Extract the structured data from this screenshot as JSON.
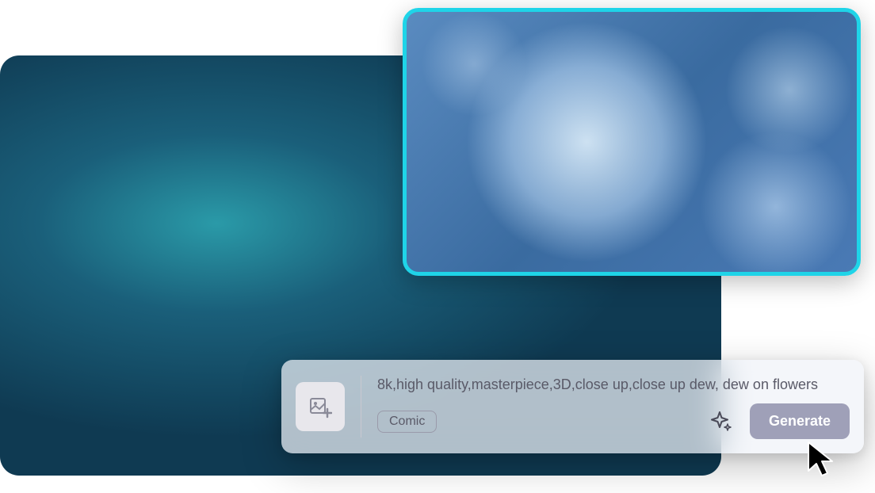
{
  "prompt": {
    "text": "8k,high quality,masterpiece,3D,close up,close up dew, dew on flowers",
    "style_tag": "Comic"
  },
  "actions": {
    "generate_label": "Generate"
  },
  "colors": {
    "preview_border": "#1fd4e8",
    "generate_bg": "#9fa0b8"
  },
  "icons": {
    "upload": "image-add-icon",
    "sparkle": "sparkle-icon",
    "cursor": "cursor-icon"
  }
}
